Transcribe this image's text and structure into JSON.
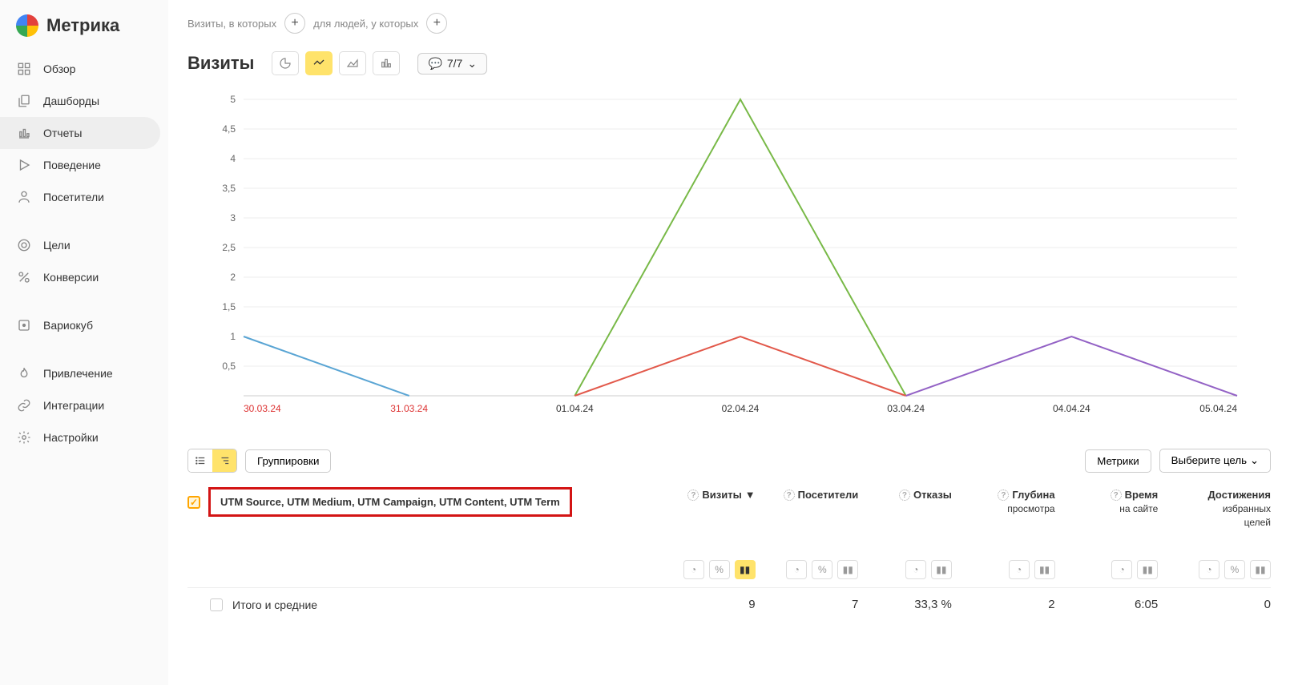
{
  "app": {
    "name": "Метрика"
  },
  "nav": {
    "overview": "Обзор",
    "dashboards": "Дашборды",
    "reports": "Отчеты",
    "behavior": "Поведение",
    "visitors": "Посетители",
    "goals": "Цели",
    "conversions": "Конверсии",
    "variokub": "Вариокуб",
    "acquisition": "Привлечение",
    "integrations": "Интеграции",
    "settings": "Настройки"
  },
  "filters": {
    "visits_where": "Визиты, в которых",
    "people_where": "для людей, у которых"
  },
  "toolbar": {
    "title": "Визиты",
    "badge": "7/7",
    "dropdown_caret": "⌄"
  },
  "bottom": {
    "groupings": "Группировки",
    "metrics": "Метрики",
    "choose_goal": "Выберите цель"
  },
  "grouping_label": "UTM Source, UTM Medium, UTM Campaign, UTM Content, UTM Term",
  "columns": {
    "visits": "Визиты",
    "sort_marker": "▼",
    "visitors": "Посетители",
    "bounces": "Отказы",
    "depth1": "Глубина",
    "depth2": "просмотра",
    "time1": "Время",
    "time2": "на сайте",
    "goals1": "Достижения",
    "goals2": "избранных",
    "goals3": "целей"
  },
  "totals": {
    "label": "Итого и средние",
    "visits": "9",
    "visitors": "7",
    "bounces": "33,3 %",
    "depth": "2",
    "time": "6:05",
    "goals": "0"
  },
  "chart_data": {
    "type": "line",
    "x_labels": [
      "30.03.24",
      "31.03.24",
      "01.04.24",
      "02.04.24",
      "03.04.24",
      "04.04.24",
      "05.04.24"
    ],
    "y_ticks": [
      0.5,
      1,
      1.5,
      2,
      2.5,
      3,
      3.5,
      4,
      4.5,
      5
    ],
    "ylim": [
      0,
      5
    ],
    "series": [
      {
        "name": "series-blue",
        "color": "#5aa5d4",
        "values": [
          1,
          0,
          null,
          null,
          null,
          null,
          null
        ]
      },
      {
        "name": "series-green",
        "color": "#78b947",
        "values": [
          null,
          null,
          0,
          5,
          0,
          null,
          null
        ]
      },
      {
        "name": "series-red",
        "color": "#e2594b",
        "values": [
          null,
          null,
          0,
          1,
          0,
          null,
          null
        ]
      },
      {
        "name": "series-purple",
        "color": "#9362c5",
        "values": [
          null,
          null,
          null,
          null,
          0,
          1,
          0
        ]
      }
    ],
    "weekend_indices": [
      0,
      1
    ]
  }
}
